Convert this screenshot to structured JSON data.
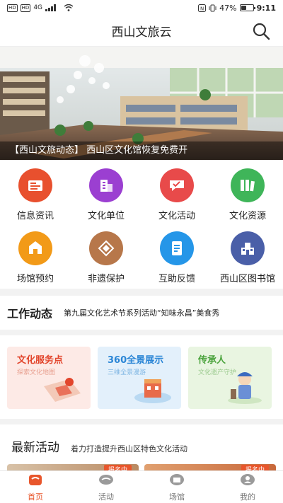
{
  "status_bar": {
    "left_chips": [
      "HD",
      "HD"
    ],
    "signal": "4G",
    "time": "9:11",
    "battery": "47%",
    "battery_level_percent": 47
  },
  "app_bar": {
    "title": "西山文旅云",
    "search_icon": "search-icon"
  },
  "banner": {
    "caption": "【西山文旅动态】 西山区文化馆恢复免费开"
  },
  "grid": {
    "items": [
      {
        "label": "信息资讯",
        "icon": "news-icon",
        "color": "#e8502e"
      },
      {
        "label": "文化单位",
        "icon": "building-icon",
        "color": "#9b3fd1"
      },
      {
        "label": "文化活动",
        "icon": "activity-icon",
        "color": "#e84a4a"
      },
      {
        "label": "文化资源",
        "icon": "resource-icon",
        "color": "#3fb559"
      },
      {
        "label": "场馆预约",
        "icon": "venue-booking-icon",
        "color": "#f29a18"
      },
      {
        "label": "非遗保护",
        "icon": "heritage-icon",
        "color": "#b7774a"
      },
      {
        "label": "互助反馈",
        "icon": "feedback-icon",
        "color": "#2596e8"
      },
      {
        "label": "西山区图书馆",
        "icon": "library-icon",
        "color": "#4a5fa8"
      }
    ]
  },
  "news_ticker": {
    "heading": "工作动态",
    "text": "第九届文化艺术节系列活动“知味永昌”美食秀"
  },
  "feature_cards": [
    {
      "title": "文化服务点",
      "subtitle": "探索文化地图",
      "bg": "#fdeae6",
      "title_color": "#e2452c",
      "sub_color": "#e8a090"
    },
    {
      "title": "360全景展示",
      "subtitle": "三维全景漫游",
      "bg": "#e3f0fb",
      "title_color": "#2b86d6",
      "sub_color": "#7fb6e3"
    },
    {
      "title": "传承人",
      "subtitle": "文化遗产守护",
      "bg": "#e9f5e1",
      "title_color": "#4aa33c",
      "sub_color": "#9dcb90"
    }
  ],
  "latest": {
    "title": "最新活动",
    "subtitle": "着力打造提升西山区特色文化活动",
    "tags": [
      "报名中",
      "报名中"
    ]
  },
  "tab_bar": {
    "active_color": "#e8562c",
    "tabs": [
      {
        "label": "首页",
        "icon": "home-icon",
        "active": true
      },
      {
        "label": "活动",
        "icon": "activity-tab-icon",
        "active": false
      },
      {
        "label": "场馆",
        "icon": "venue-icon",
        "active": false
      },
      {
        "label": "我的",
        "icon": "profile-icon",
        "active": false
      }
    ]
  }
}
